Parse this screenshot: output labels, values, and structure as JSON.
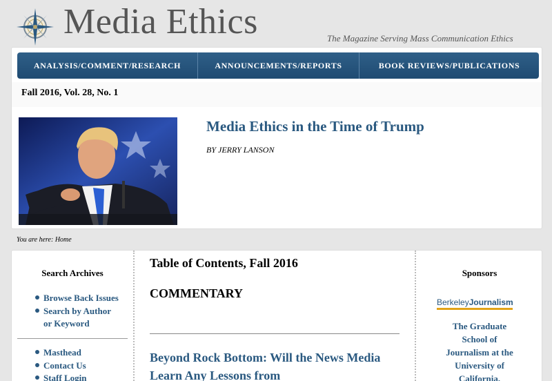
{
  "header": {
    "title": "Media Ethics",
    "tagline": "The Magazine Serving Mass Communication Ethics"
  },
  "nav": {
    "items": [
      {
        "label": "ANALYSIS/COMMENT/RESEARCH"
      },
      {
        "label": "ANNOUNCEMENTS/REPORTS"
      },
      {
        "label": "BOOK REVIEWS/PUBLICATIONS"
      }
    ]
  },
  "issue": "Fall 2016, Vol. 28, No. 1",
  "feature": {
    "title": "Media Ethics in the Time of Trump",
    "byline": "BY JERRY LANSON"
  },
  "breadcrumb": "You are here: Home",
  "sidebar": {
    "heading": "Search Archives",
    "links": [
      {
        "label": "Browse Back Issues"
      },
      {
        "label": "Search by Author or Keyword"
      }
    ],
    "links2": [
      {
        "label": "Masthead"
      },
      {
        "label": "Contact Us"
      },
      {
        "label": "Staff Login"
      }
    ]
  },
  "content": {
    "toc_title": "Table of Contents, Fall 2016",
    "section": "COMMENTARY",
    "article": "Beyond Rock Bottom: Will the News Media Learn Any Lessons from"
  },
  "sponsors": {
    "heading": "Sponsors",
    "logo_light": "Berkeley",
    "logo_bold": "Journalism",
    "text": "The Graduate School of Journalism at the University of California,"
  }
}
